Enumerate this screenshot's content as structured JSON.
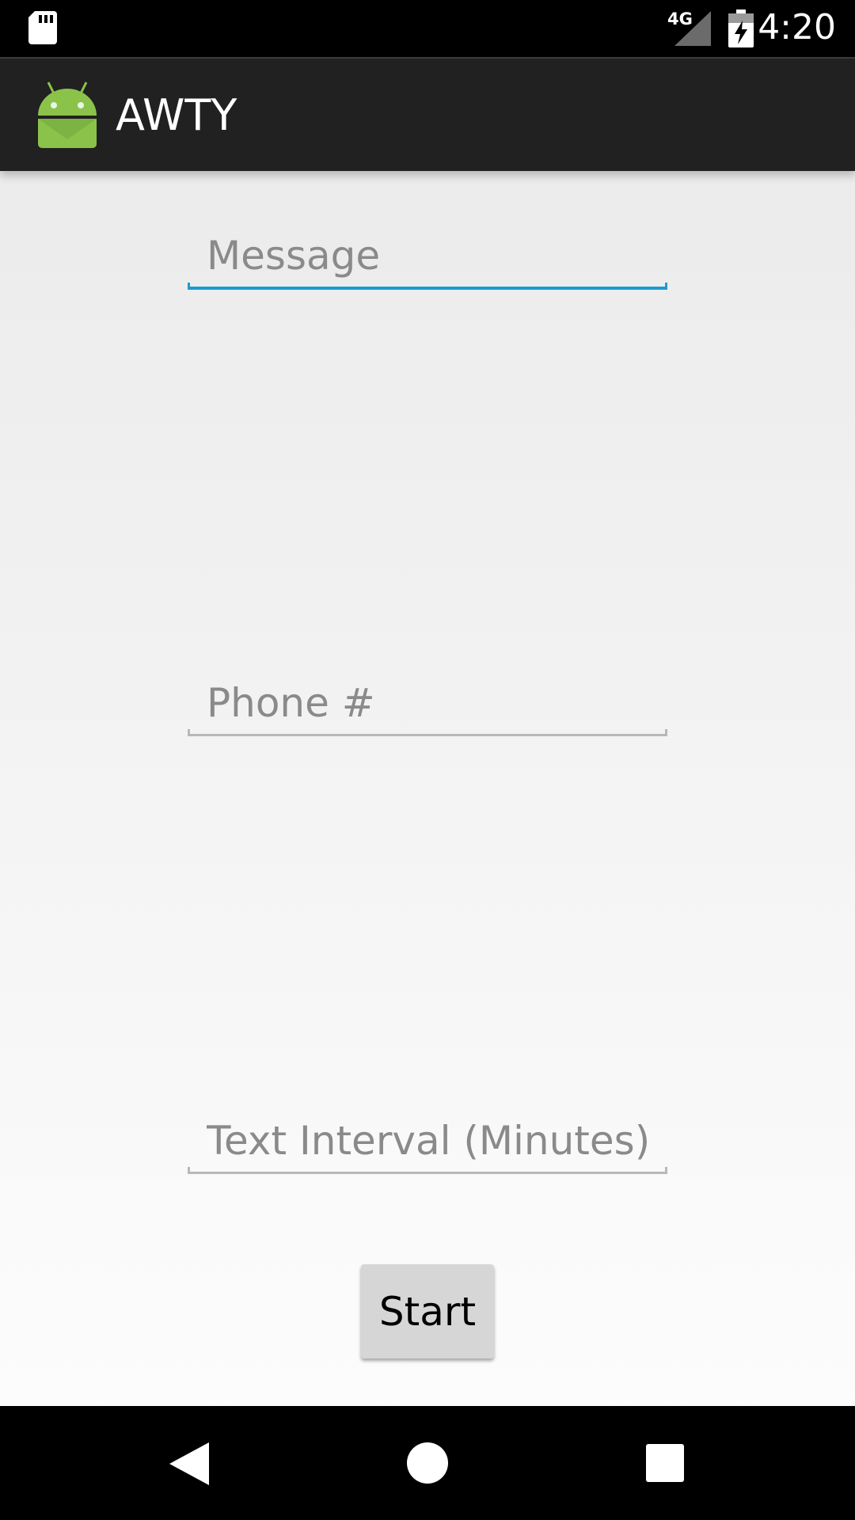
{
  "status_bar": {
    "network_label": "4G",
    "time": "4:20",
    "icons": [
      "sd-card-icon",
      "signal-icon",
      "battery-charging-icon"
    ]
  },
  "app_bar": {
    "title": "AWTY",
    "icon": "android-icon"
  },
  "form": {
    "message_placeholder": "Message",
    "message_value": "",
    "phone_placeholder": "Phone #",
    "phone_value": "",
    "interval_placeholder": "Text Interval (Minutes)",
    "interval_value": "",
    "start_label": "Start"
  },
  "nav_bar": {
    "icons": [
      "back-icon",
      "home-icon",
      "recents-icon"
    ]
  },
  "colors": {
    "status_bar": "#000000",
    "app_bar": "#212121",
    "focus_accent": "#1a9bd1",
    "android_green": "#8bc34a",
    "button": "#d6d6d6"
  }
}
